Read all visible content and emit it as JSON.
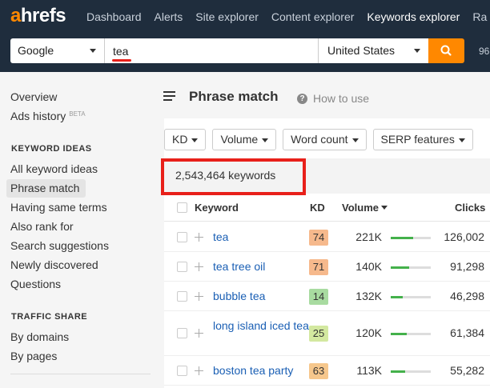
{
  "app": {
    "logo_a": "a",
    "logo_rest": "hrefs",
    "nav": [
      "Dashboard",
      "Alerts",
      "Site explorer",
      "Content explorer",
      "Keywords explorer",
      "Ra"
    ],
    "active_nav": "Keywords explorer",
    "credits": "96"
  },
  "search": {
    "engine": "Google",
    "query": "tea",
    "country": "United States"
  },
  "sidebar": {
    "overview": "Overview",
    "ads_history": "Ads history",
    "ads_badge": "BETA",
    "keyword_ideas_heading": "KEYWORD IDEAS",
    "keyword_ideas": [
      "All keyword ideas",
      "Phrase match",
      "Having same terms",
      "Also rank for",
      "Search suggestions",
      "Newly discovered",
      "Questions"
    ],
    "active_item": "Phrase match",
    "traffic_share_heading": "TRAFFIC SHARE",
    "traffic_share": [
      "By domains",
      "By pages"
    ]
  },
  "main": {
    "title": "Phrase match",
    "help": "How to use",
    "filters": [
      "KD",
      "Volume",
      "Word count",
      "SERP features"
    ],
    "count": "2,543,464 keywords",
    "columns": {
      "keyword": "Keyword",
      "kd": "KD",
      "volume": "Volume",
      "clicks": "Clicks"
    },
    "rows": [
      {
        "keyword": "tea",
        "kd": "74",
        "kd_color": "#f6b98c",
        "volume": "221K",
        "volume_fill": 0.55,
        "clicks": "126,002"
      },
      {
        "keyword": "tea tree oil",
        "kd": "71",
        "kd_color": "#f6b98c",
        "volume": "140K",
        "volume_fill": 0.45,
        "clicks": "91,298"
      },
      {
        "keyword": "bubble tea",
        "kd": "14",
        "kd_color": "#a8dba0",
        "volume": "132K",
        "volume_fill": 0.3,
        "clicks": "46,298"
      },
      {
        "keyword": "long island iced tea",
        "kd": "25",
        "kd_color": "#d3e8a0",
        "volume": "120K",
        "volume_fill": 0.4,
        "clicks": "61,384"
      },
      {
        "keyword": "boston tea party",
        "kd": "63",
        "kd_color": "#f6c78c",
        "volume": "113K",
        "volume_fill": 0.35,
        "clicks": "55,282"
      }
    ]
  },
  "colors": {
    "brand_orange": "#ff8800",
    "topbar": "#1f2d3d",
    "highlight_red": "#e8201a",
    "link_blue": "#1a5fb4",
    "volume_bar": "#44b14b"
  }
}
